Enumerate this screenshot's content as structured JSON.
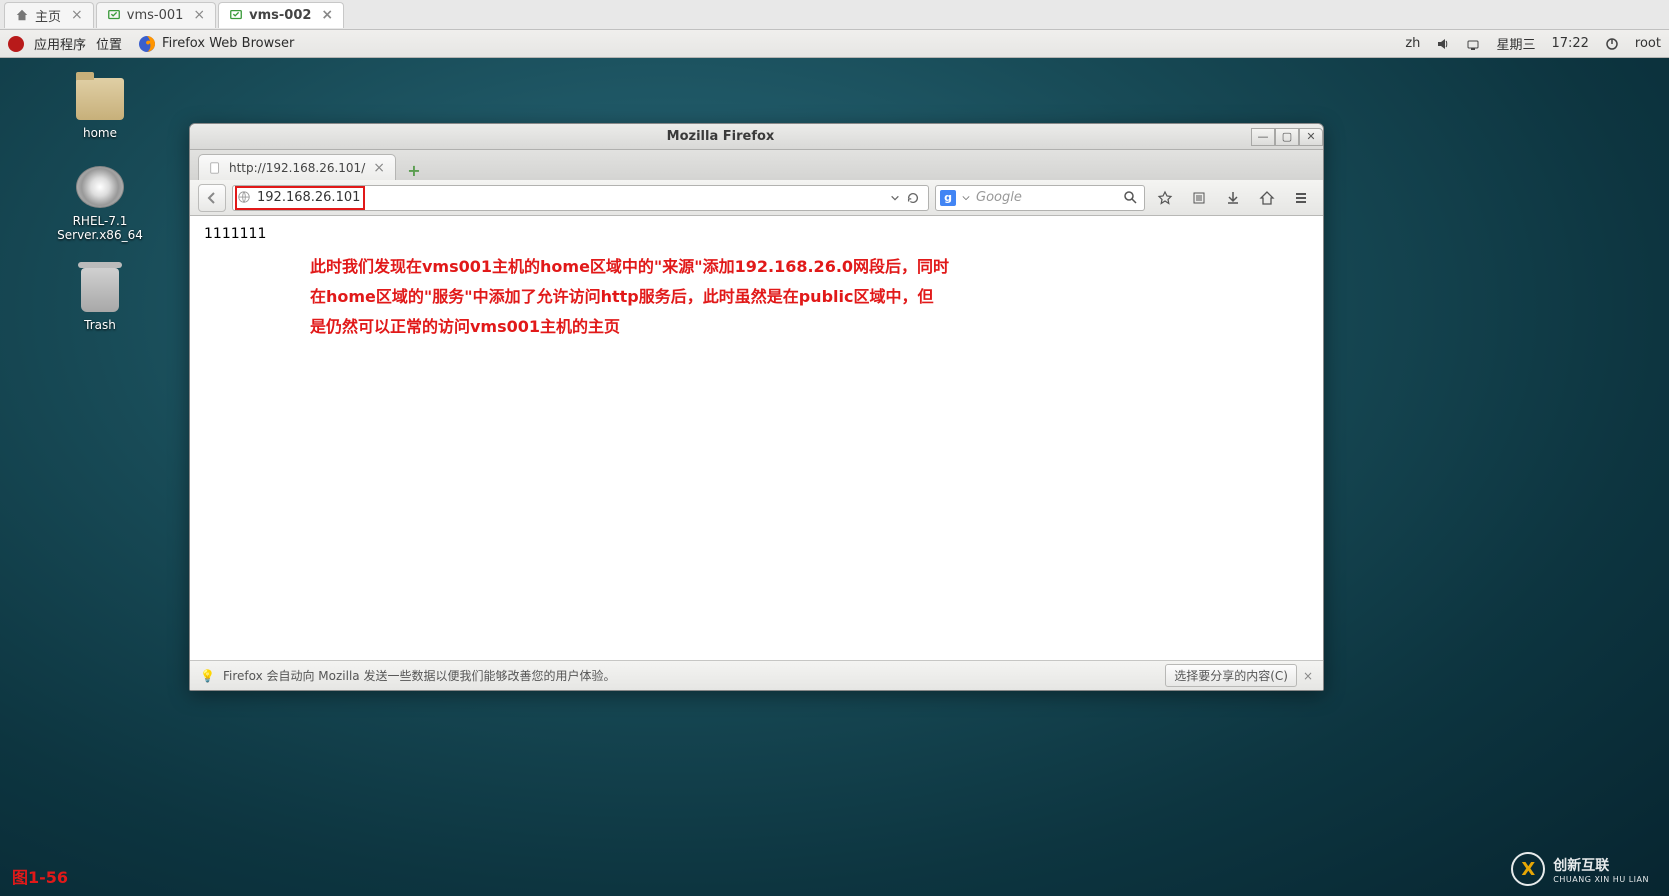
{
  "host_tabs": {
    "items": [
      {
        "label": "主页"
      },
      {
        "label": "vms-001"
      },
      {
        "label": "vms-002"
      }
    ],
    "active_index": 2
  },
  "gnome": {
    "apps_label": "应用程序",
    "places_label": "位置",
    "task_label": "Firefox Web Browser",
    "ime": "zh",
    "day": "星期三",
    "time": "17:22",
    "user": "root"
  },
  "desktop_icons": {
    "home": "home",
    "disc": "RHEL-7.1 Server.x86_64",
    "trash": "Trash"
  },
  "firefox": {
    "window_title": "Mozilla Firefox",
    "tab_title": "http://192.168.26.101/",
    "url": "192.168.26.101",
    "search_placeholder": "Google",
    "status_msg": "Firefox 会自动向 Mozilla 发送一些数据以便我们能够改善您的用户体验。",
    "share_button": "选择要分享的内容(C)"
  },
  "page": {
    "body_text": "1111111"
  },
  "annotation": {
    "line1": "此时我们发现在vms001主机的home区域中的\"来源\"添加192.168.26.0网段后，同时",
    "line2": "在home区域的\"服务\"中添加了允许访问http服务后，此时虽然是在public区域中，但",
    "line3": "是仍然可以正常的访问vms001主机的主页"
  },
  "figure_label": "图1-56",
  "brand": {
    "name": "创新互联",
    "sub": "CHUANG XIN HU LIAN"
  }
}
